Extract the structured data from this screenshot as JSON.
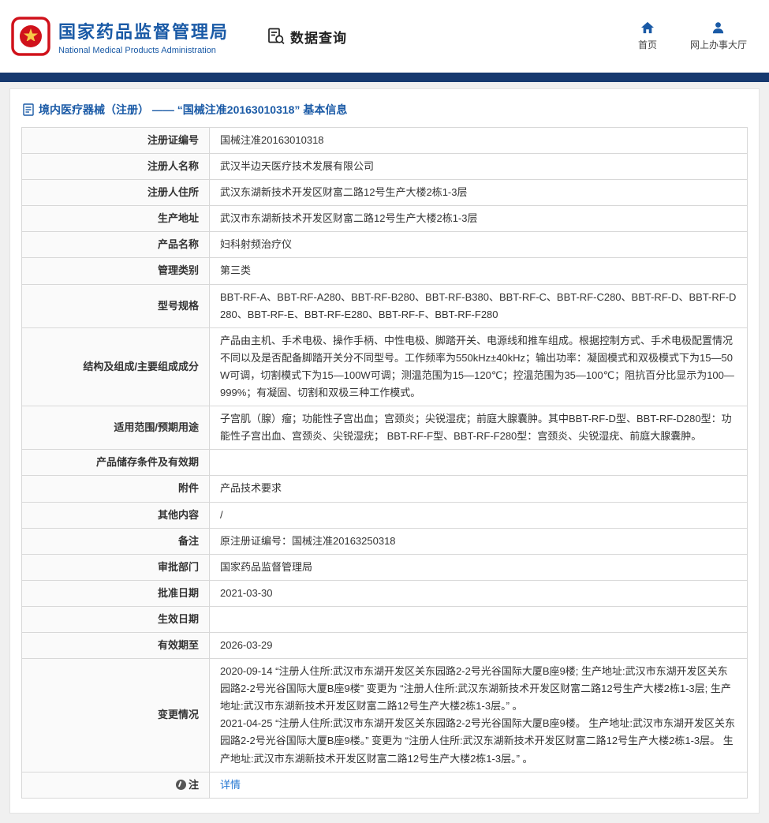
{
  "colors": {
    "brand_blue": "#1a5aa6",
    "navbar_dark_blue": "#16396f",
    "link_blue": "#2577d2",
    "logo_red": "#d0121b"
  },
  "icons": {
    "nmpa-logo": "red national emblem in rounded red square",
    "data-query-icon": "document with magnifying glass",
    "home-icon": "blue house",
    "user-icon": "blue person silhouette",
    "document-icon": "blue page sheet",
    "note-icon": "dark circle with pen mark"
  },
  "header": {
    "org_name_cn": "国家药品监督管理局",
    "org_name_en": "National Medical Products Administration",
    "nav_data_query": "数据查询",
    "nav_home": "首页",
    "nav_service_hall": "网上办事大厅"
  },
  "page": {
    "title": "境内医疗器械（注册） ——  “国械注准20163010318” 基本信息"
  },
  "table": {
    "rows": [
      {
        "label": "注册证编号",
        "value": "国械注准20163010318"
      },
      {
        "label": "注册人名称",
        "value": "武汉半边天医疗技术发展有限公司"
      },
      {
        "label": "注册人住所",
        "value": "武汉东湖新技术开发区财富二路12号生产大楼2栋1-3层"
      },
      {
        "label": "生产地址",
        "value": "武汉市东湖新技术开发区财富二路12号生产大楼2栋1-3层"
      },
      {
        "label": "产品名称",
        "value": "妇科射频治疗仪"
      },
      {
        "label": "管理类别",
        "value": "第三类"
      },
      {
        "label": "型号规格",
        "value": "BBT-RF-A、BBT-RF-A280、BBT-RF-B280、BBT-RF-B380、BBT-RF-C、BBT-RF-C280、BBT-RF-D、BBT-RF-D280、BBT-RF-E、BBT-RF-E280、BBT-RF-F、BBT-RF-F280"
      },
      {
        "label": "结构及组成/主要组成成分",
        "value": "产品由主机、手术电极、操作手柄、中性电极、脚踏开关、电源线和推车组成。根据控制方式、手术电极配置情况不同以及是否配备脚踏开关分不同型号。工作频率为550kHz±40kHz；输出功率：凝固模式和双极模式下为15—50W可调，切割模式下为15—100W可调；测温范围为15—120℃；控温范围为35—100℃；阻抗百分比显示为100—999%；有凝固、切割和双极三种工作模式。"
      },
      {
        "label": "适用范围/预期用途",
        "value": "子宫肌（腺）瘤；功能性子宫出血；宫颈炎；尖锐湿疣；前庭大腺囊肿。其中BBT-RF-D型、BBT-RF-D280型：功能性子宫出血、宫颈炎、尖锐湿疣； BBT-RF-F型、BBT-RF-F280型：宫颈炎、尖锐湿疣、前庭大腺囊肿。"
      },
      {
        "label": "产品储存条件及有效期",
        "value": ""
      },
      {
        "label": "附件",
        "value": "产品技术要求"
      },
      {
        "label": "其他内容",
        "value": "/"
      },
      {
        "label": "备注",
        "value": "原注册证编号：国械注准20163250318"
      },
      {
        "label": "审批部门",
        "value": "国家药品监督管理局"
      },
      {
        "label": "批准日期",
        "value": "2021-03-30"
      },
      {
        "label": "生效日期",
        "value": ""
      },
      {
        "label": "有效期至",
        "value": "2026-03-29"
      },
      {
        "label": "变更情况",
        "value": "2020-09-14  “注册人住所:武汉市东湖开发区关东园路2-2号光谷国际大厦B座9楼; 生产地址:武汉市东湖开发区关东园路2-2号光谷国际大厦B座9楼” 变更为 “注册人住所:武汉东湖新技术开发区财富二路12号生产大楼2栋1-3层; 生产地址:武汉市东湖新技术开发区财富二路12号生产大楼2栋1-3层。” 。\n2021-04-25  “注册人住所:武汉市东湖开发区关东园路2-2号光谷国际大厦B座9楼。 生产地址:武汉市东湖开发区关东园路2-2号光谷国际大厦B座9楼。” 变更为 “注册人住所:武汉东湖新技术开发区财富二路12号生产大楼2栋1-3层。 生产地址:武汉市东湖新技术开发区财富二路12号生产大楼2栋1-3层。” 。"
      }
    ],
    "note_row": {
      "label": "注",
      "link": "详情"
    }
  }
}
